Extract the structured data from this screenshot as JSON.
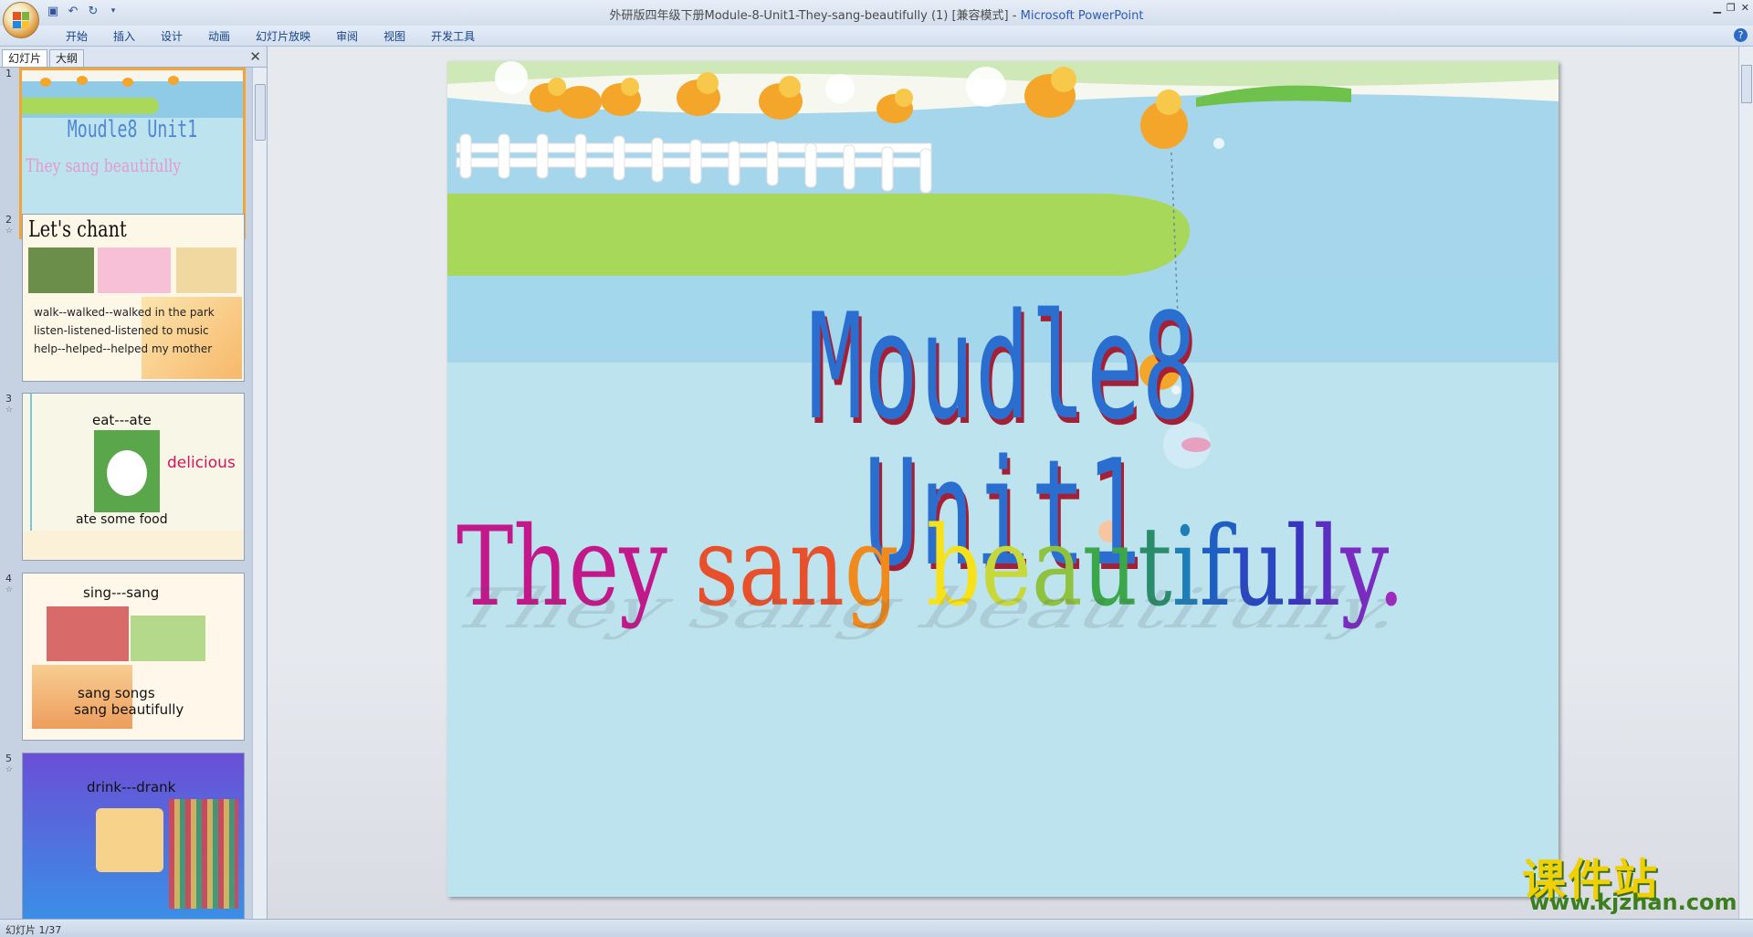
{
  "window": {
    "title": "外研版四年级下册Module-8-Unit1-They-sang-beautifully (1) [兼容模式]",
    "app_name": "Microsoft PowerPoint",
    "separator": " - "
  },
  "quick_access": [
    "save-icon",
    "undo-icon",
    "redo-icon",
    "customize-icon"
  ],
  "menu": [
    "开始",
    "插入",
    "设计",
    "动画",
    "幻灯片放映",
    "审阅",
    "视图",
    "开发工具"
  ],
  "pane": {
    "tabs": [
      {
        "label": "幻灯片",
        "active": true
      },
      {
        "label": "大纲",
        "active": false
      }
    ],
    "close_glyph": "✕",
    "slides": [
      {
        "number": "1",
        "title": "Moudle8 Unit1",
        "subtitle": "They sang beautifully"
      },
      {
        "number": "2",
        "title": "Let's chant",
        "lines": [
          "walk--walked--walked in the park",
          "listen-listened-listened to music",
          "help--helped--helped my mother"
        ]
      },
      {
        "number": "3",
        "lines": [
          "eat---ate",
          "delicious",
          "ate some food"
        ]
      },
      {
        "number": "4",
        "lines": [
          "sing---sang",
          "sang songs",
          "sang beautifully"
        ]
      },
      {
        "number": "5",
        "lines": [
          "drink---drank"
        ]
      }
    ]
  },
  "slide": {
    "title": "Moudle8 Unit1",
    "subtitle": "They sang beautifully.",
    "subtitle_colors": [
      "#c2188a",
      "#c2188a",
      "#c2188a",
      "#c2188a",
      "#ffffff",
      "#e8502c",
      "#e8502c",
      "#e8502c",
      "#f08a1c",
      "#ffffff",
      "#f6e11a",
      "#c7d83a",
      "#8fc23e",
      "#3ca64a",
      "#2a8c6b",
      "#1e7fb8",
      "#1f5fc4",
      "#2947c2",
      "#3a35c0",
      "#5b2fc0",
      "#7a2bc0",
      "#a02ac0"
    ]
  },
  "status": {
    "text": "幻灯片 1/37"
  },
  "watermark": {
    "cn": "课件站",
    "url": "www.kjzhan.com"
  }
}
